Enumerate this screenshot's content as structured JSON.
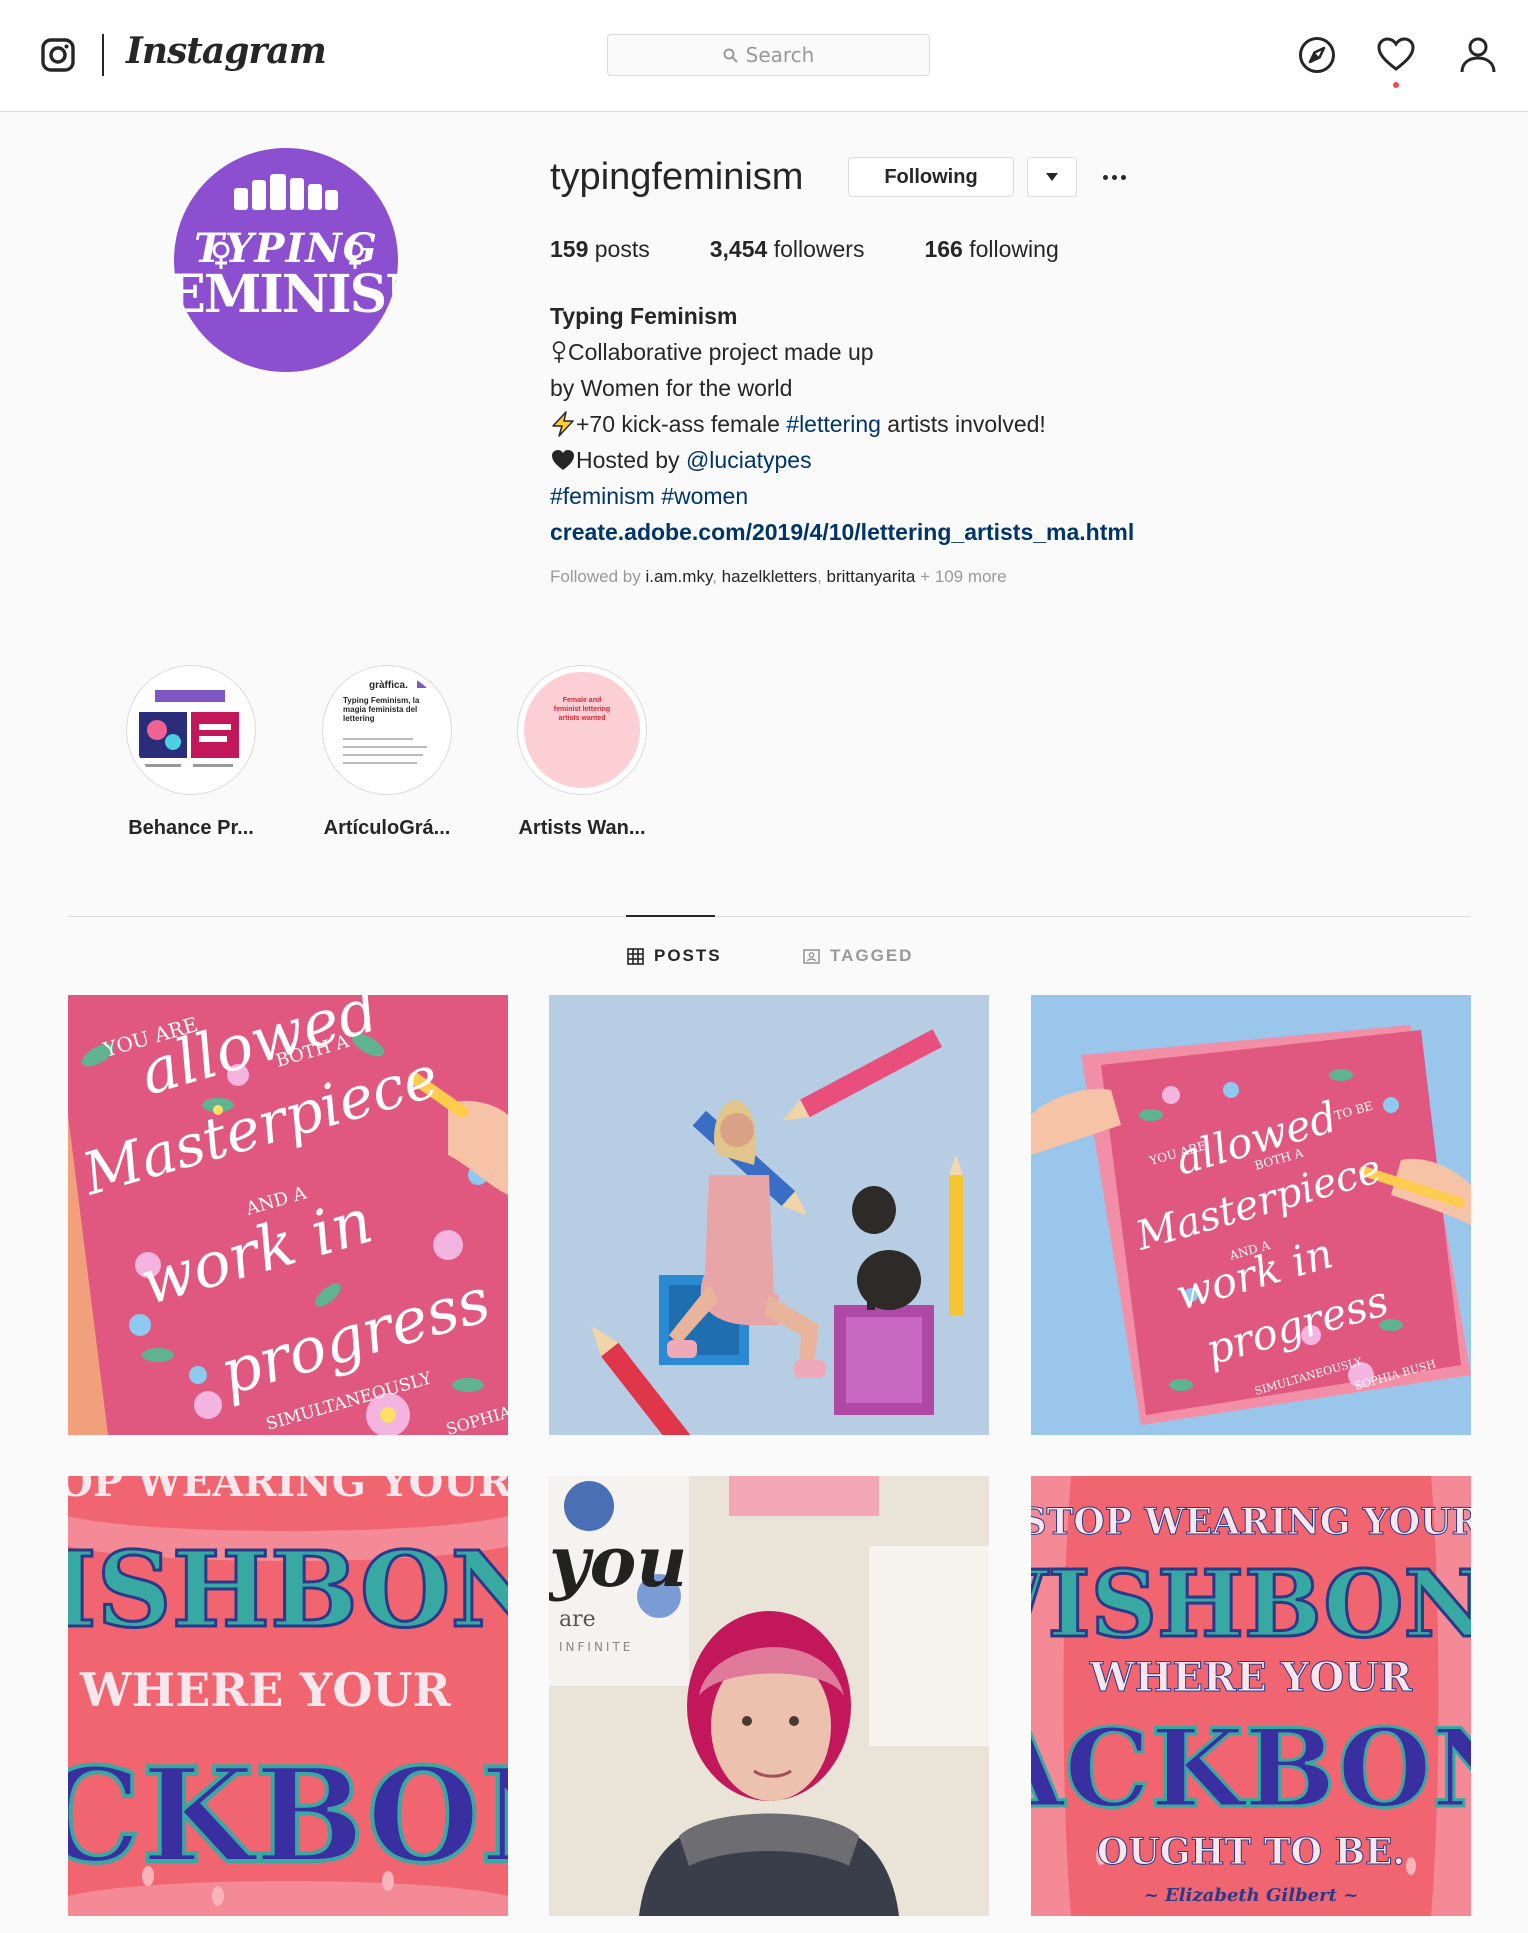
{
  "nav": {
    "brand": "Instagram",
    "search_placeholder": "Search",
    "icons": [
      "instagram-glyph-icon",
      "search-icon",
      "compass-icon",
      "heart-icon",
      "user-icon"
    ]
  },
  "profile": {
    "username": "typingfeminism",
    "following_label": "Following",
    "stats": {
      "posts_count": "159",
      "posts_label": "posts",
      "followers_count": "3,454",
      "followers_label": "followers",
      "following_count": "166",
      "following_label": "following"
    },
    "avatar_text": {
      "line1": "TYPING",
      "line2": "FEMINISM"
    },
    "bio": {
      "full_name": "Typing Feminism",
      "line1": "Collaborative project made up",
      "line2": "by Women for the world",
      "line3_pre": "+70 kick-ass female ",
      "line3_tag": "#lettering",
      "line3_post": " artists involved!",
      "line4_pre": "Hosted by ",
      "line4_mention": "@luciatypes",
      "tag_feminism": "#feminism",
      "tag_women": "#women",
      "link": "create.adobe.com/2019/4/10/lettering_artists_ma.html"
    },
    "followed_by": {
      "prefix": "Followed by ",
      "user1": "i.am.mky",
      "user2": "hazelkletters",
      "user3": "brittanyarita",
      "more": " + 109 more"
    }
  },
  "highlights": [
    {
      "label": "Behance Pr..."
    },
    {
      "label": "ArtículoGrá...",
      "thumb_title": "gràffica.",
      "thumb_heading": "Typing Feminism, la magia feminista del lettering"
    },
    {
      "label": "Artists Wan...",
      "thumb_text": "Female and feminist lettering artists wanted"
    }
  ],
  "tabs": [
    {
      "label": "POSTS",
      "active": true
    },
    {
      "label": "TAGGED",
      "active": false
    }
  ],
  "posts": [
    {
      "kind": "lettering",
      "text": [
        "YOU ARE",
        "allowed",
        "BOTH A",
        "Masterpiece",
        "AND A",
        "work in",
        "progress",
        "SIMULTANEOUSLY",
        "SOPHIA BUSH"
      ]
    },
    {
      "kind": "photo"
    },
    {
      "kind": "lettering",
      "text": [
        "YOU ARE",
        "allowed",
        "TO BE",
        "BOTH A",
        "Masterpiece",
        "AND A",
        "work in",
        "progress",
        "SIMULTANEOUSLY",
        "SOPHIA BUSH"
      ]
    },
    {
      "kind": "lettering",
      "text": [
        "OP WEARING YOUR",
        "ISHBONE",
        "WHERE YOUR",
        "CKBONE"
      ]
    },
    {
      "kind": "photo",
      "text": [
        "you",
        "are",
        "INFINITE"
      ]
    },
    {
      "kind": "lettering",
      "text": [
        "STOP WEARING YOUR",
        "WISHBONE",
        "WHERE YOUR",
        "BACKBONE",
        "OUGHT TO BE.",
        "~ Elizabeth Gilbert ~"
      ]
    }
  ],
  "colors": {
    "link": "#003569",
    "muted": "#999999",
    "border": "#dbdbdb",
    "avatar": "#8b4fcf",
    "notification": "#ed4956"
  }
}
